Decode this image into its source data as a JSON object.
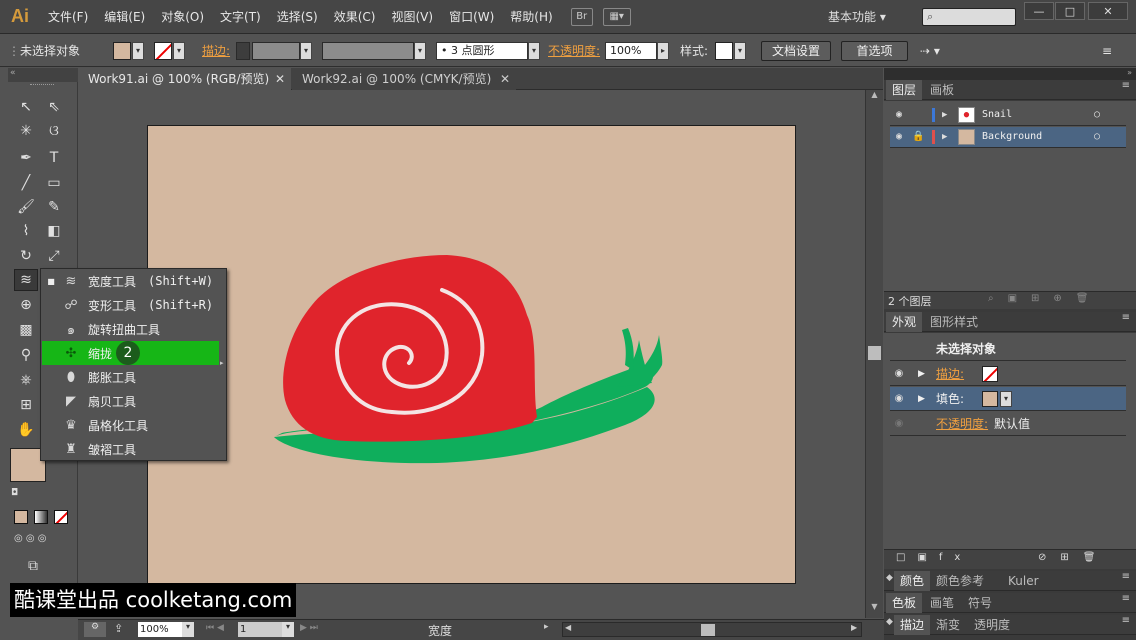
{
  "app": {
    "logo": "Ai"
  },
  "menubar": {
    "items": [
      "文件(F)",
      "编辑(E)",
      "对象(O)",
      "文字(T)",
      "选择(S)",
      "效果(C)",
      "视图(V)",
      "窗口(W)",
      "帮助(H)"
    ],
    "bridge_label": "Br",
    "workspace": "基本功能"
  },
  "control": {
    "selection_label": "未选择对象",
    "stroke_label": "描边:",
    "brush_label": "3 点圆形",
    "opacity_label": "不透明度:",
    "opacity_value": "100%",
    "style_label": "样式:",
    "doc_setup_button": "文档设置",
    "prefs_button": "首选项"
  },
  "tabs": [
    {
      "label": "Work91.ai @ 100% (RGB/预览)"
    },
    {
      "label": "Work92.ai @ 100% (CMYK/预览)"
    }
  ],
  "flyout": {
    "items": [
      {
        "label": "宽度工具",
        "shortcut": "(Shift+W)",
        "checked": true
      },
      {
        "label": "变形工具",
        "shortcut": "(Shift+R)"
      },
      {
        "label": "旋转扭曲工具",
        "shortcut": ""
      },
      {
        "label": "缩拢",
        "shortcut": "",
        "highlighted": true
      },
      {
        "label": "膨胀工具",
        "shortcut": ""
      },
      {
        "label": "扇贝工具",
        "shortcut": ""
      },
      {
        "label": "晶格化工具",
        "shortcut": ""
      },
      {
        "label": "皱褶工具",
        "shortcut": ""
      }
    ],
    "step_badge": "2"
  },
  "status": {
    "zoom": "100%",
    "page": "1",
    "tool": "宽度"
  },
  "layers_panel": {
    "tabs": [
      "图层",
      "画板"
    ],
    "layers": [
      {
        "name": "Snail",
        "color": "#3c78d8"
      },
      {
        "name": "Background",
        "color": "#e0504c"
      }
    ],
    "count": "2 个图层"
  },
  "appearance_panel": {
    "tabs": [
      "外观",
      "图形样式"
    ],
    "title": "未选择对象",
    "stroke_label": "描边:",
    "fill_label": "填色:",
    "opacity_label": "不透明度:",
    "opacity_value": "默认值"
  },
  "bottom_panels": [
    {
      "tabs": [
        "颜色",
        "颜色参考",
        "Kuler"
      ]
    },
    {
      "tabs": [
        "色板",
        "画笔",
        "符号"
      ]
    },
    {
      "tabs": [
        "描边",
        "渐变",
        "透明度"
      ]
    }
  ],
  "watermark": "酷课堂出品 coolketang.com",
  "colors": {
    "artboard": "#d4b8a0",
    "snail_shell": "#e0242c",
    "snail_body": "#0fae5c",
    "highlight": "#16b616"
  }
}
